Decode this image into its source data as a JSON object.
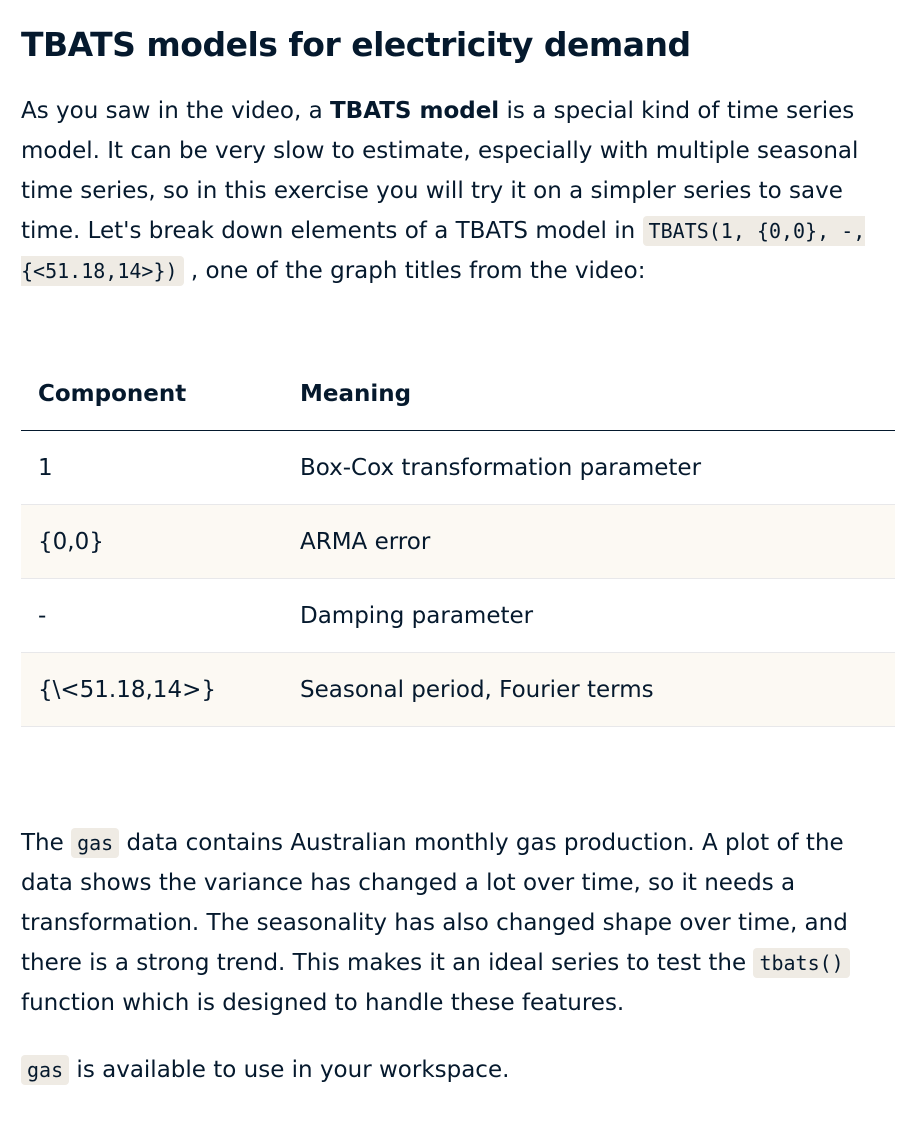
{
  "title": "TBATS models for electricity demand",
  "intro": {
    "t1": "As you saw in the video, a ",
    "bold": "TBATS model",
    "t2": " is a special kind of time series model. It can be very slow to estimate, especially with multiple seasonal time series, so in this exercise you will try it on a simpler series to save time. Let's break down elements of a TBATS model in ",
    "code": "TBATS(1, {0,0}, -, {<51.18,14>})",
    "t3": " , one of the graph titles from the video:"
  },
  "table": {
    "headers": [
      "Component",
      "Meaning"
    ],
    "rows": [
      [
        "1",
        "Box-Cox transformation parameter"
      ],
      [
        "{0,0}",
        "ARMA error"
      ],
      [
        "-",
        "Damping parameter"
      ],
      [
        "{\\<51.18,14>}",
        "Seasonal period, Fourier terms"
      ]
    ]
  },
  "para2": {
    "t1": "The ",
    "code1": "gas",
    "t2": " data contains Australian monthly gas production. A plot of the data shows the variance has changed a lot over time, so it needs a transformation. The seasonality has also changed shape over time, and there is a strong trend. This makes it an ideal series to test the ",
    "code2": "tbats()",
    "t3": " function which is designed to handle these features."
  },
  "para3": {
    "code": "gas",
    "t1": " is available to use in your workspace."
  }
}
